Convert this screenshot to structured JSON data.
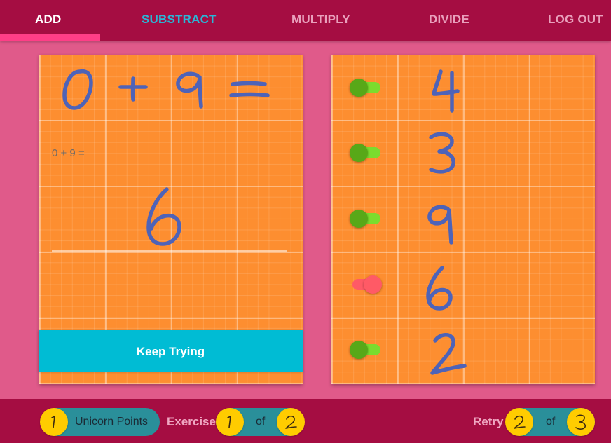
{
  "nav": {
    "tabs": [
      {
        "label": "ADD",
        "active": true
      },
      {
        "label": "SUBSTRACT",
        "active": false
      },
      {
        "label": "MULTIPLY",
        "active": false
      },
      {
        "label": "DIVIDE",
        "active": false
      },
      {
        "label": "LOG OUT",
        "active": false
      }
    ],
    "colors": {
      "bar": "#a50d42",
      "indicator": "#ff3e87",
      "active": "#ffffff",
      "substract": "#2ab6d6"
    }
  },
  "exercise": {
    "handwritten_equation": "0 + 9 =",
    "equation_text": "0 + 9 =",
    "handwritten_answer": "6",
    "feedback_button": "Keep Trying"
  },
  "history": {
    "items": [
      {
        "answer": "4",
        "correct": true
      },
      {
        "answer": "3",
        "correct": true
      },
      {
        "answer": "9",
        "correct": true
      },
      {
        "answer": "6",
        "correct": false
      },
      {
        "answer": "2",
        "correct": true
      }
    ]
  },
  "footer": {
    "unicorn_points_value": "1",
    "unicorn_points_label": "Unicorn Points",
    "exercise_label": "Exercise",
    "exercise_current": "1",
    "exercise_of": "of",
    "exercise_total": "2",
    "retry_label": "Retry",
    "retry_current": "2",
    "retry_of": "of",
    "retry_total": "3"
  },
  "colors": {
    "background": "#e05a8a",
    "card": "#fd8e30",
    "handwriting": "#4e63b8",
    "keep_trying": "#00bcd4",
    "toggle_on": "#7bdc2e",
    "toggle_off": "#ff5a66",
    "coin": "#ffcc00",
    "pill": "#2a8f9a"
  }
}
